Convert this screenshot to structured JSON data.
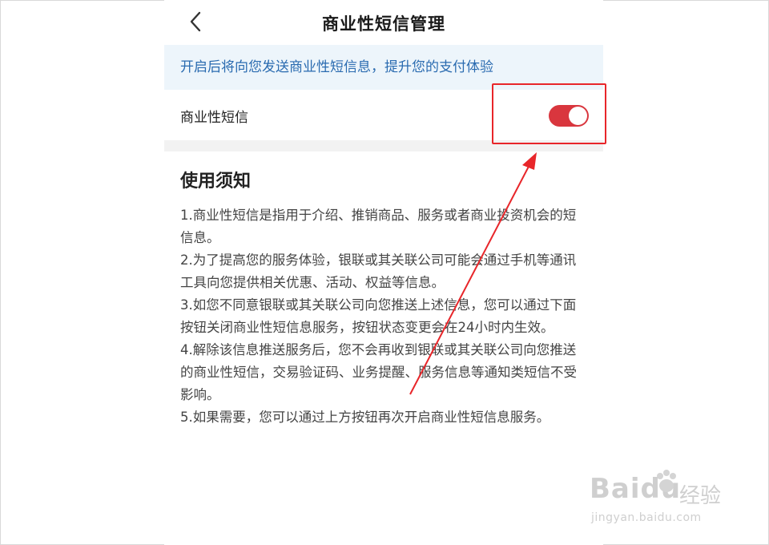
{
  "header": {
    "title": "商业性短信管理",
    "back_icon": "chevron-left-icon"
  },
  "banner": {
    "text": "开启后将向您发送商业性短信息，提升您的支付体验"
  },
  "setting": {
    "label": "商业性短信",
    "toggle_state": "on",
    "toggle_color": "#d9363e"
  },
  "notice": {
    "title": "使用须知",
    "items": [
      "1.商业性短信是指用于介绍、推销商品、服务或者商业投资机会的短信息。",
      "2.为了提高您的服务体验，银联或其关联公司可能会通过手机等通讯工具向您提供相关优惠、活动、权益等信息。",
      "3.如您不同意银联或其关联公司向您推送上述信息，您可以通过下面按钮关闭商业性短信息服务，按钮状态变更会在24小时内生效。",
      "4.解除该信息推送服务后，您不会再收到银联或其关联公司向您推送的商业性短信，交易验证码、业务提醒、服务信息等通知类短信不受影响。",
      "5.如果需要，您可以通过上方按钮再次开启商业性短信息服务。"
    ]
  },
  "annotation": {
    "color": "#e8262a"
  },
  "watermark": {
    "brand": "Baidu",
    "text": "经验",
    "url": "jingyan.baidu.com"
  }
}
